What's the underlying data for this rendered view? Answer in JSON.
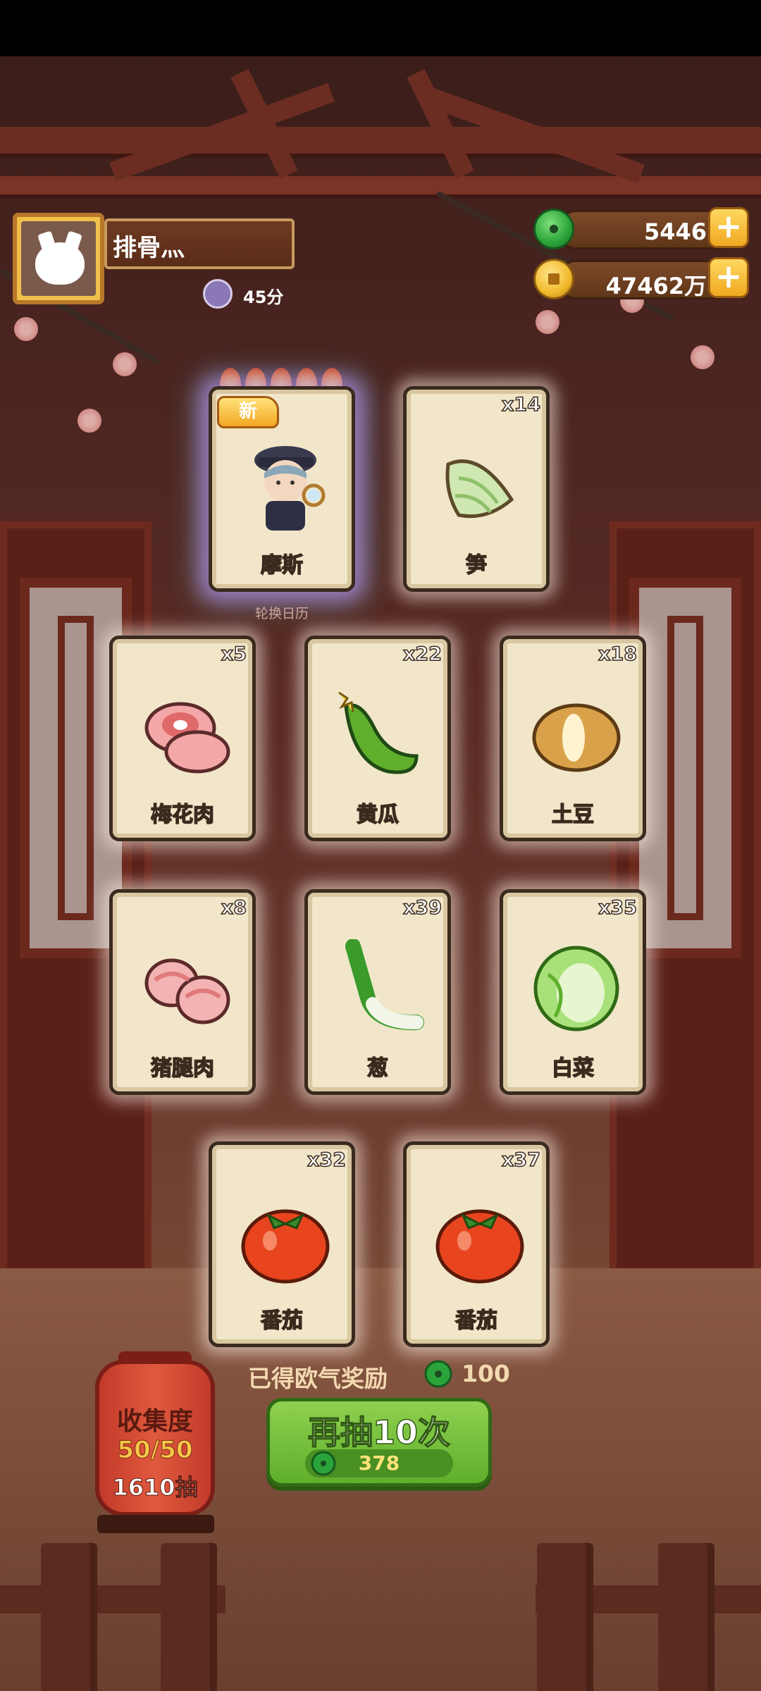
{
  "player": {
    "name": "排骨灬",
    "score": "45分"
  },
  "currency": {
    "jade": "5446",
    "coins": "47462万",
    "jade_color": "#2aa33a",
    "coin_color": "#f2b92c"
  },
  "draw_results": {
    "featured": [
      {
        "label": "摩斯",
        "count": "",
        "is_new": true,
        "new_tag": "新",
        "caption": "轮换日历",
        "stars": 5
      },
      {
        "label": "笋",
        "count": "x14"
      }
    ],
    "row2": [
      {
        "label": "梅花肉",
        "count": "x5"
      },
      {
        "label": "黄瓜",
        "count": "x22"
      },
      {
        "label": "土豆",
        "count": "x18"
      }
    ],
    "row3": [
      {
        "label": "猪腿肉",
        "count": "x8"
      },
      {
        "label": "葱",
        "count": "x39"
      },
      {
        "label": "白菜",
        "count": "x35"
      }
    ],
    "row4": [
      {
        "label": "番茄",
        "count": "x32"
      },
      {
        "label": "番茄",
        "count": "x37"
      }
    ]
  },
  "reward": {
    "text": "已得欧气奖励",
    "amount": "100"
  },
  "collection": {
    "title": "收集度",
    "progress": "50/50",
    "draws": "1610抽"
  },
  "draw_again": {
    "label": "再抽10次",
    "cost": "378"
  }
}
